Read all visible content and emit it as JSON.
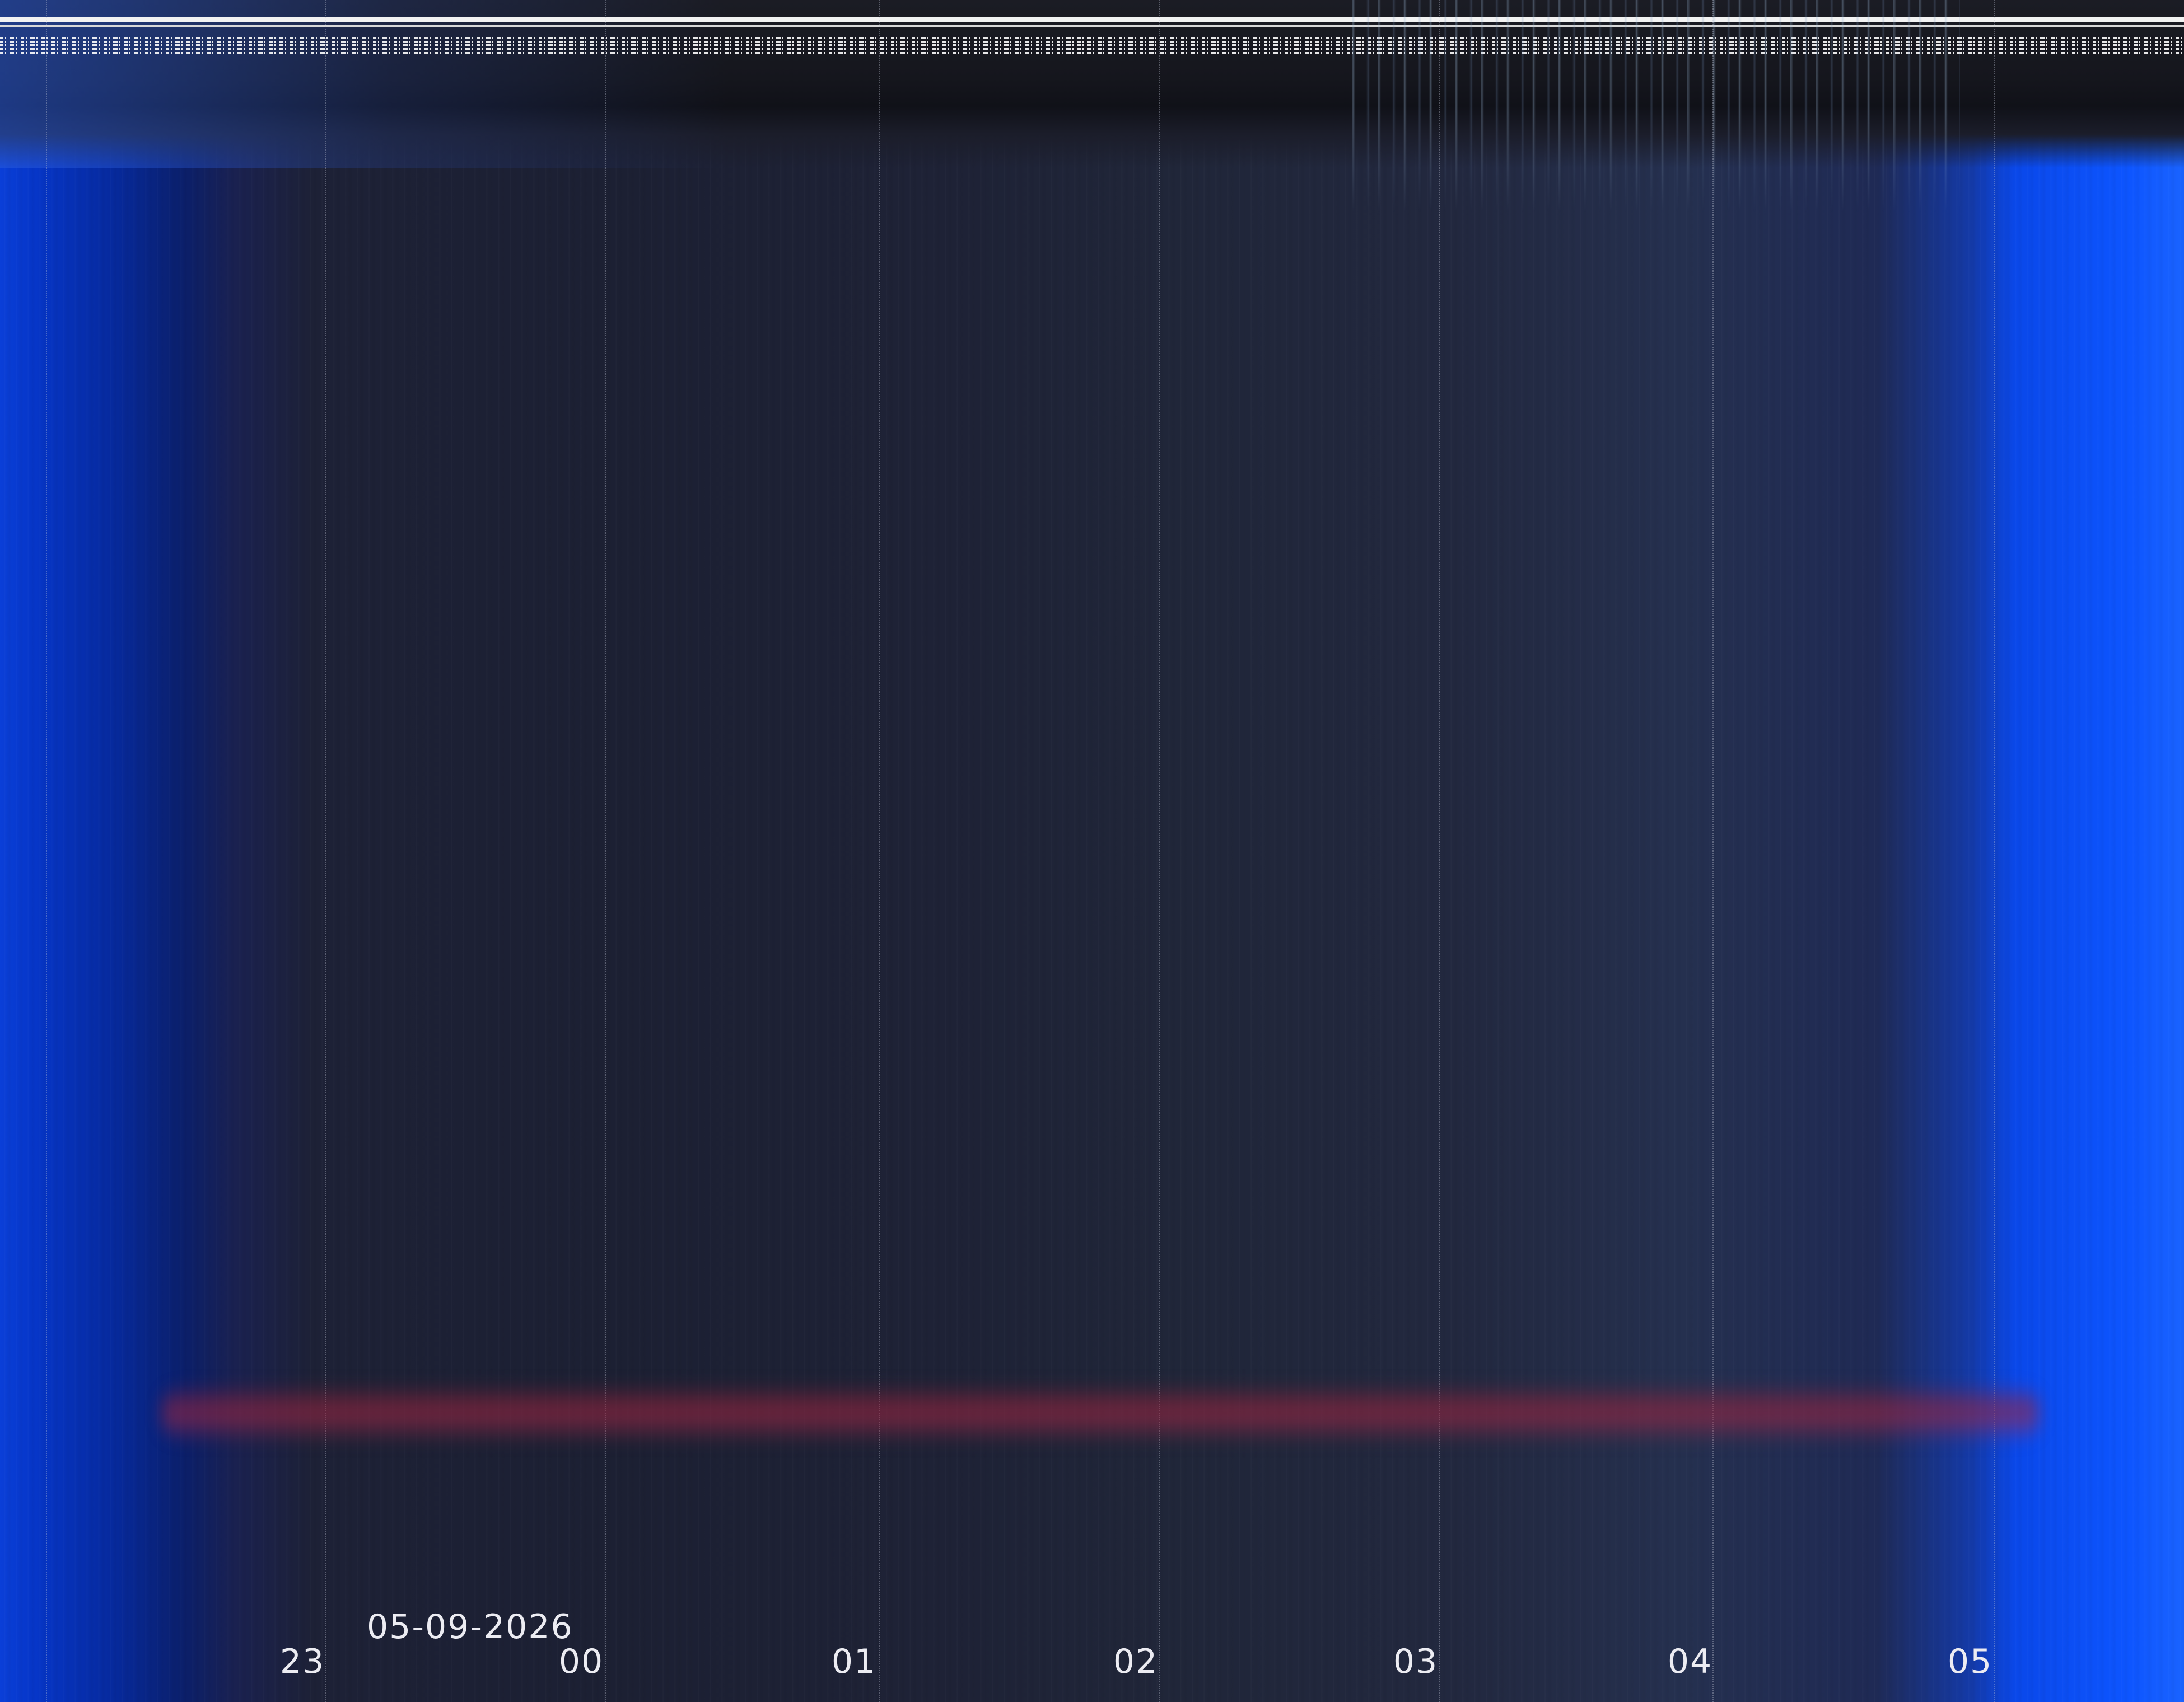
{
  "timeline": {
    "date": "05-09-2026",
    "hour_labels": [
      "23",
      "00",
      "01",
      "02",
      "03",
      "04",
      "05"
    ]
  },
  "colors": {
    "background": "#1c2033",
    "edge_glow": "#0d55ff",
    "band": "#9b2846",
    "gridline": "#bec3d2",
    "text": "#ececf2"
  }
}
